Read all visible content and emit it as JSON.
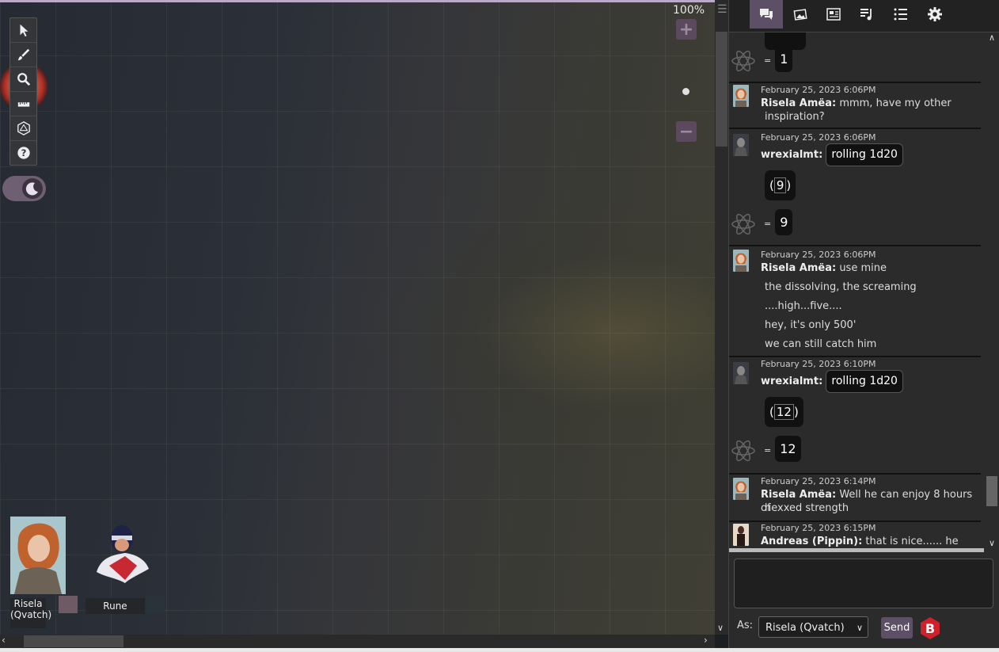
{
  "canvas": {
    "zoom_label": "100%"
  },
  "tools": [
    "select",
    "draw",
    "zoom",
    "measure",
    "dice",
    "help"
  ],
  "players": [
    {
      "name": "Risela (Qvatch)",
      "color": "#6e5a64"
    },
    {
      "name": "Rune",
      "color": "#2a323a"
    }
  ],
  "chat": {
    "tabs": [
      "chat-tab",
      "art-tab",
      "journal-tab",
      "jukebox-tab",
      "compendium-tab",
      "settings-tab"
    ],
    "messages": [
      {
        "kind": "result-only",
        "result": "1"
      },
      {
        "kind": "text",
        "time": "February 25, 2023 6:06PM",
        "who": "Risela Amëa:",
        "lines": [
          "mmm, have my other",
          "inspiration?"
        ]
      },
      {
        "kind": "roll",
        "time": "February 25, 2023 6:06PM",
        "who": "wrexialmt:",
        "formula": "rolling 1d20",
        "die": "9",
        "result": "9"
      },
      {
        "kind": "text",
        "time": "February 25, 2023 6:06PM",
        "who": "Risela Amëa:",
        "lines": [
          "use mine",
          "the dissolving, the screaming",
          "....high...five....",
          "hey, it's only 500'",
          "we can still catch him"
        ]
      },
      {
        "kind": "roll",
        "time": "February 25, 2023 6:10PM",
        "who": "wrexialmt:",
        "formula": "rolling 1d20",
        "die": "12",
        "result": "12"
      },
      {
        "kind": "text",
        "time": "February 25, 2023 6:14PM",
        "who": "Risela Amëa:",
        "lines": [
          "Well he can enjoy 8 hours of",
          "hexxed strength"
        ]
      },
      {
        "kind": "text",
        "time": "February 25, 2023 6:15PM",
        "who": "Andreas (Pippin):",
        "lines": [
          "that is nice...... he gets"
        ]
      }
    ],
    "input_value": "",
    "as_label": "As:",
    "as_selected": "Risela (Qvatch)",
    "send_label": "Send"
  }
}
